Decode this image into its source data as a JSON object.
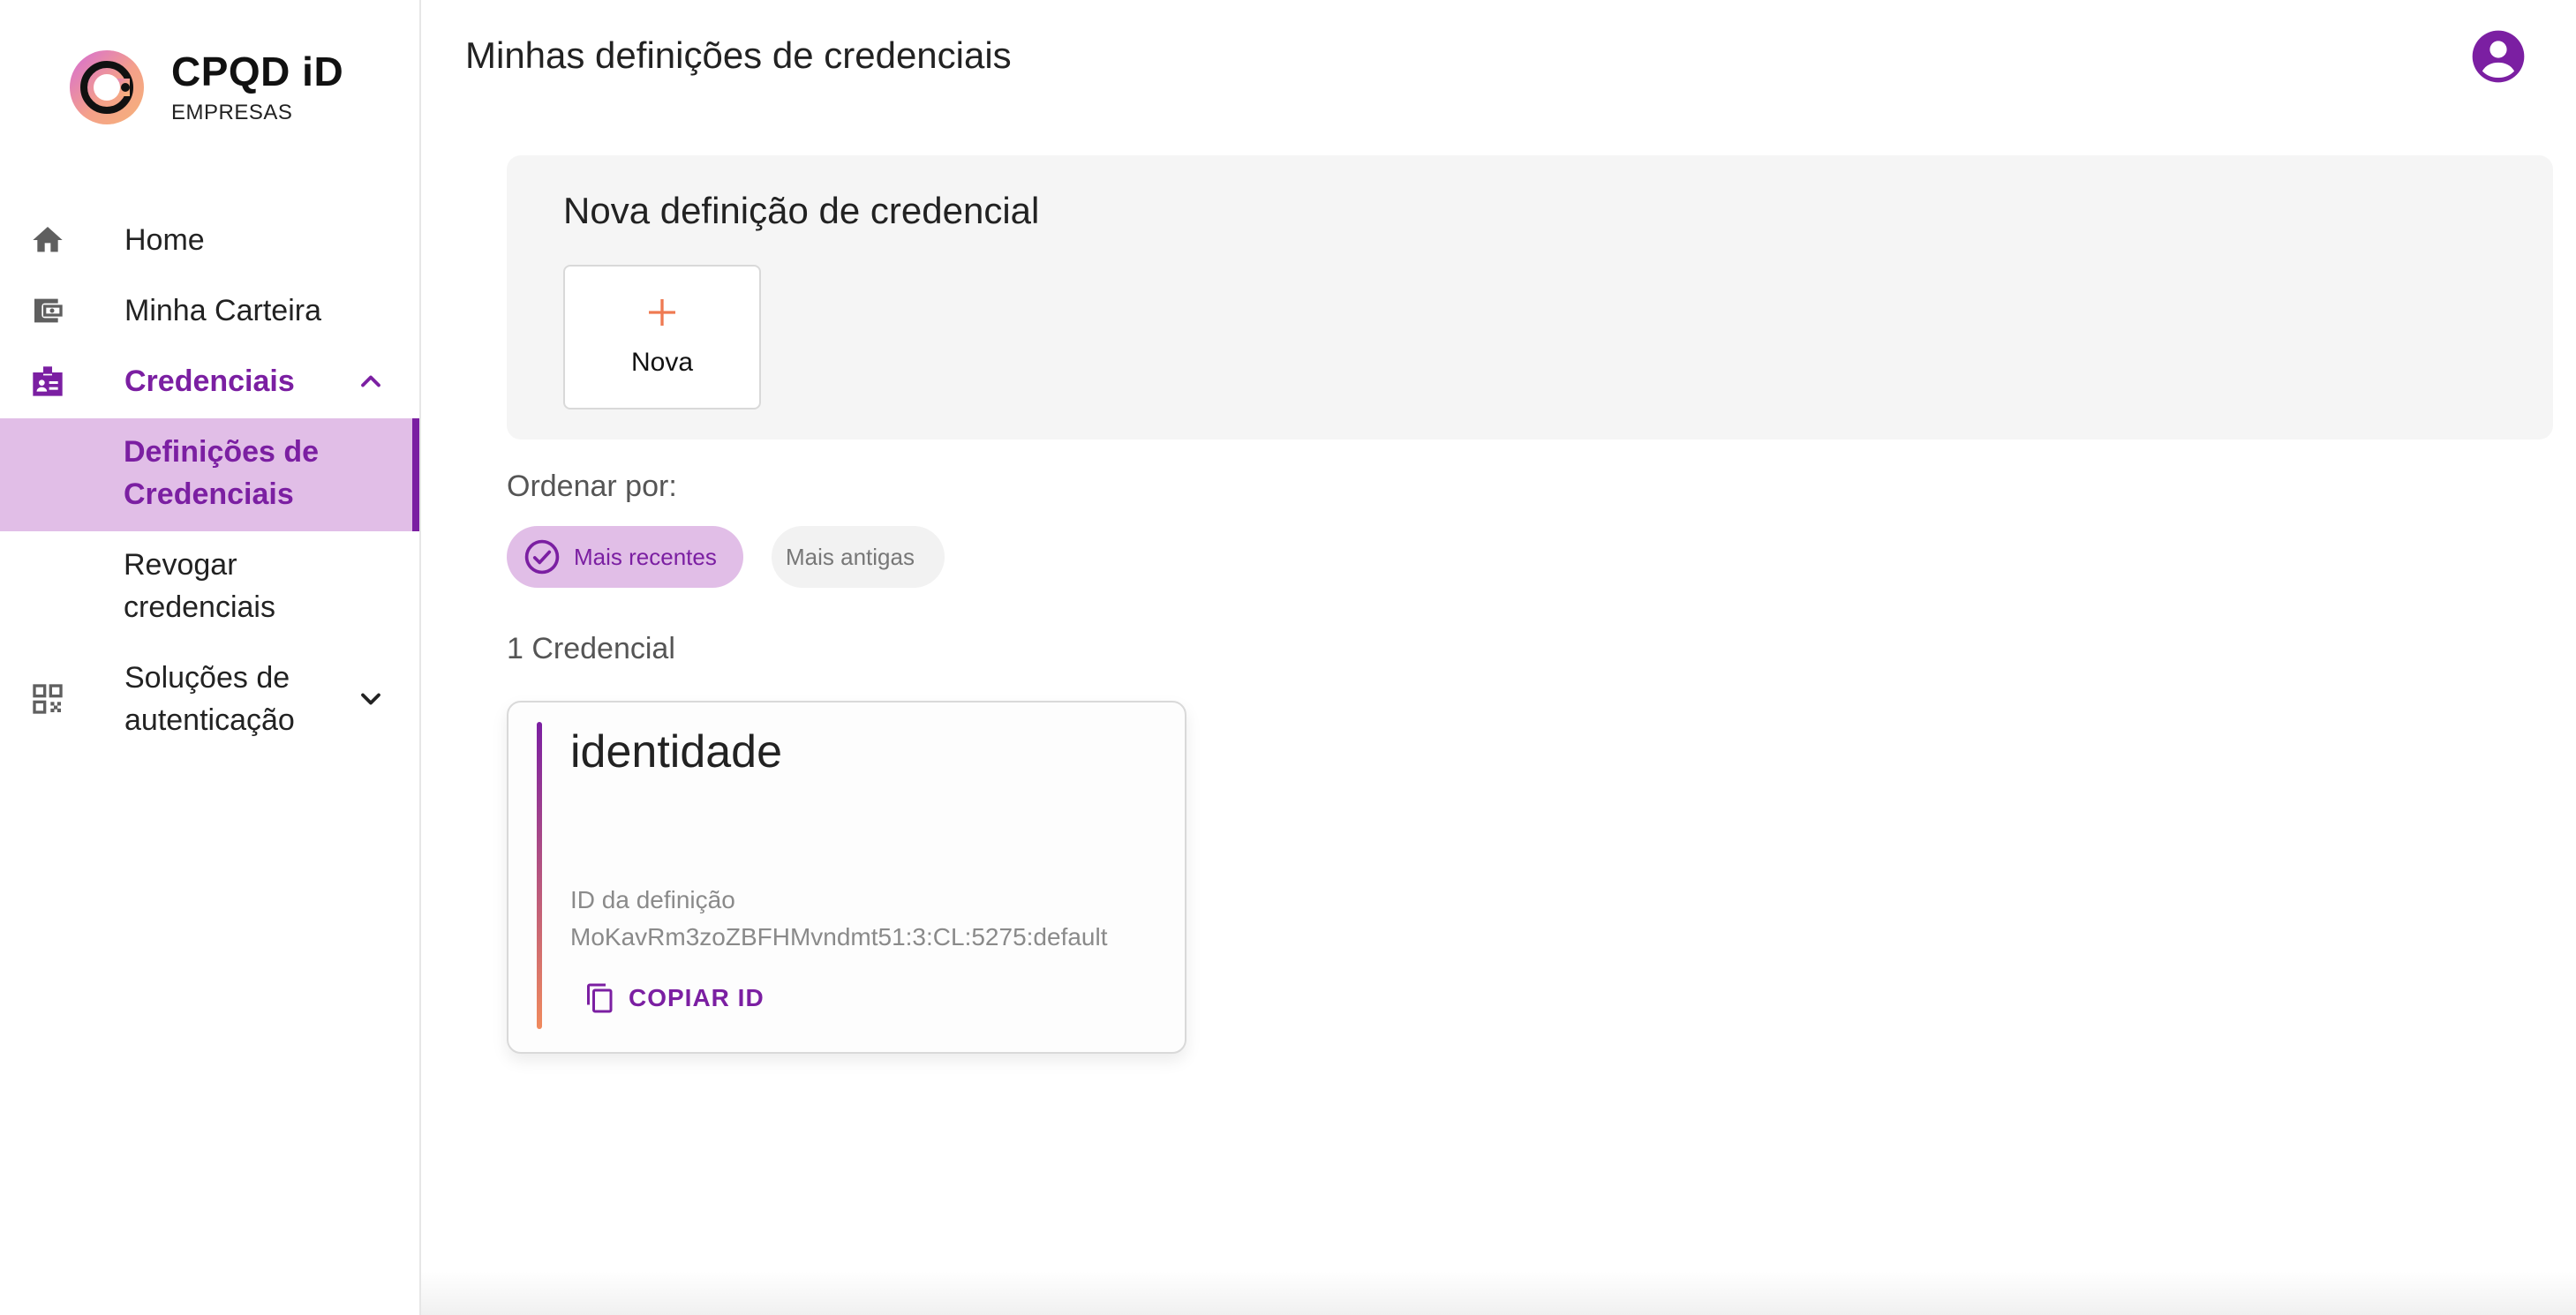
{
  "brand": {
    "name": "CPQD iD",
    "subtitle": "EMPRESAS"
  },
  "sidebar": {
    "items": [
      {
        "label": "Home",
        "icon": "home-icon"
      },
      {
        "label": "Minha Carteira",
        "icon": "wallet-icon"
      },
      {
        "label": "Credenciais",
        "icon": "badge-icon",
        "expanded": true,
        "active": true
      },
      {
        "label": "Soluções de autenticação",
        "icon": "qr-code-icon",
        "expanded": false
      }
    ],
    "sub_items": [
      {
        "label": "Definições de Credenciais",
        "selected": true
      },
      {
        "label": "Revogar credenciais",
        "selected": false
      }
    ]
  },
  "header": {
    "title": "Minhas definições de credenciais",
    "avatar_icon": "account-circle-icon"
  },
  "new_panel": {
    "title": "Nova definição de credencial",
    "button_label": "Nova",
    "button_icon": "plus-icon"
  },
  "sort": {
    "label": "Ordenar por:",
    "options": [
      {
        "label": "Mais recentes",
        "selected": true
      },
      {
        "label": "Mais antigas",
        "selected": false
      }
    ]
  },
  "credentials": {
    "count_label": "1 Credencial",
    "items": [
      {
        "title": "identidade",
        "id_label": "ID da definição",
        "id_value": "MoKavRm3zoZBFHMvndmt51:3:CL:5275:default",
        "copy_label": "COPIAR ID"
      }
    ]
  },
  "colors": {
    "accent": "#7b1fa2",
    "accent_light": "#e1bee7",
    "gradient_end": "#f08a5d",
    "panel_bg": "#f5f5f5"
  }
}
